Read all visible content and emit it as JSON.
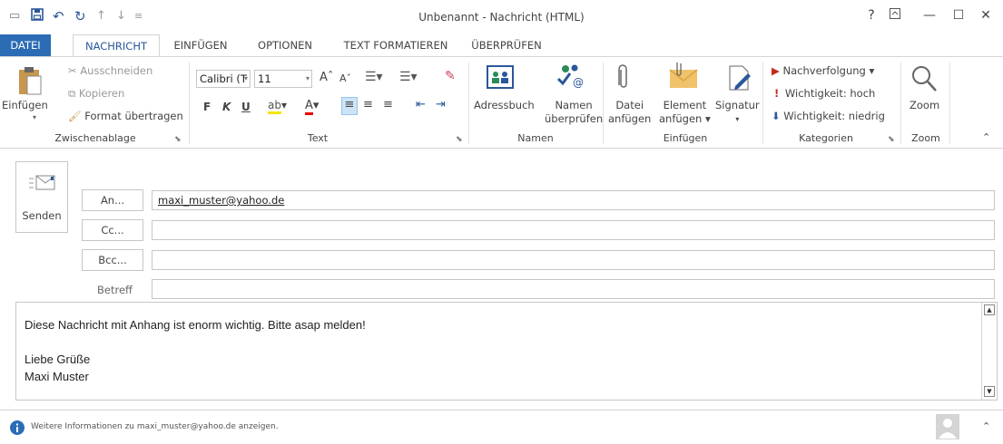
{
  "titlebar": {
    "title": "Unbenannt - Nachricht (HTML)",
    "help": "?",
    "minimize": "—",
    "maximize": "☐",
    "close": "✕"
  },
  "tabs": [
    {
      "label": "DATEI"
    },
    {
      "label": "NACHRICHT"
    },
    {
      "label": "EINFÜGEN"
    },
    {
      "label": "OPTIONEN"
    },
    {
      "label": "TEXT FORMATIEREN"
    },
    {
      "label": "ÜBERPRÜFEN"
    }
  ],
  "ribbon": {
    "clipboard": {
      "paste": "Einfügen",
      "cut": "Ausschneiden",
      "copy": "Kopieren",
      "format_painter": "Format übertragen",
      "group": "Zwischenablage"
    },
    "text": {
      "font": "Calibri (T",
      "size": "11",
      "bold": "F",
      "italic": "K",
      "underline": "U",
      "group": "Text"
    },
    "names": {
      "address_book": "Adressbuch",
      "check_names_1": "Namen",
      "check_names_2": "überprüfen",
      "group": "Namen"
    },
    "insert": {
      "attach_file_1": "Datei",
      "attach_file_2": "anfügen",
      "attach_item_1": "Element",
      "attach_item_2": "anfügen ▾",
      "signature": "Signatur",
      "group": "Einfügen"
    },
    "tags": {
      "follow_up": "Nachverfolgung ▾",
      "high": "Wichtigkeit: hoch",
      "low": "Wichtigkeit: niedrig",
      "group": "Kategorien"
    },
    "zoom": {
      "zoom": "Zoom",
      "group": "Zoom"
    }
  },
  "compose": {
    "send": "Senden",
    "to_label": "An...",
    "to_value": "maxi_muster@yahoo.de",
    "cc_label": "Cc...",
    "bcc_label": "Bcc...",
    "subject_label": "Betreff",
    "body_lines": [
      "Diese Nachricht mit Anhang ist enorm wichtig. Bitte asap melden!",
      "Liebe Grüße",
      "Maxi Muster"
    ]
  },
  "statusbar": {
    "info": "Weitere Informationen zu maxi_muster@yahoo.de anzeigen."
  },
  "colors": {
    "accent": "#2b579a",
    "file_tab": "#2b6cb5",
    "flag_red": "#c42b1c",
    "info_blue": "#2b6cb5"
  }
}
